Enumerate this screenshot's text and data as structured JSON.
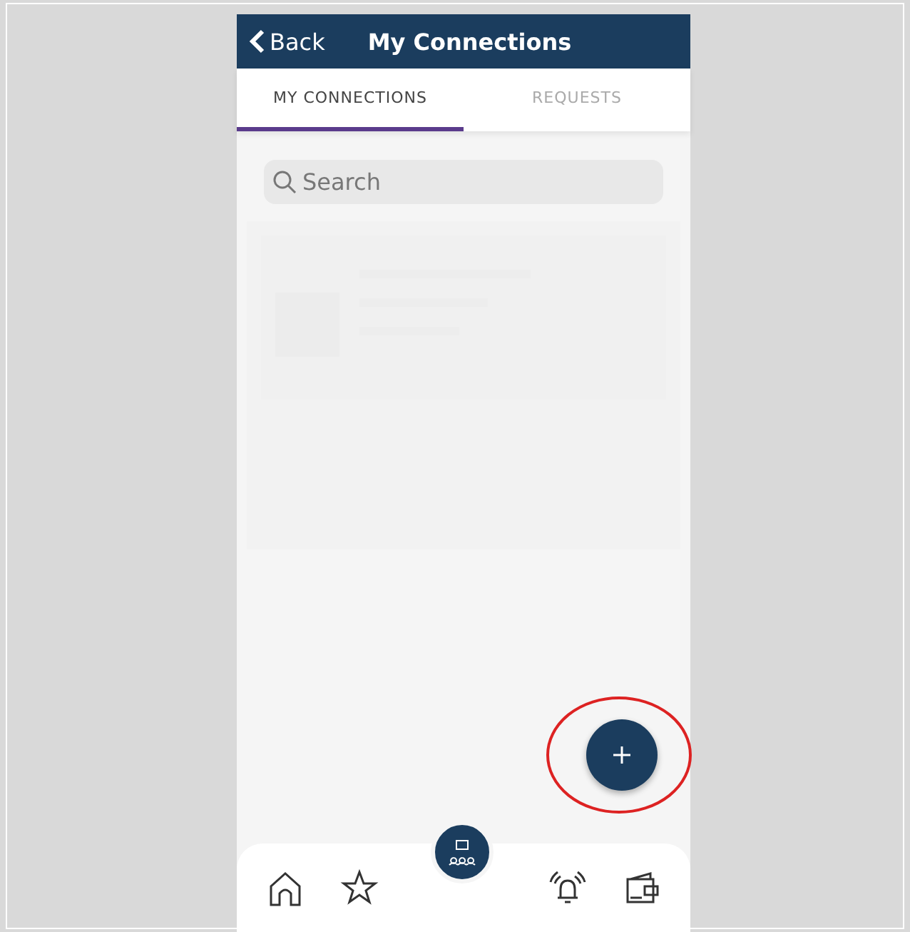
{
  "header": {
    "back": "Back",
    "title": "My Connections"
  },
  "tabs": [
    {
      "label": "MY CONNECTIONS",
      "selected": true
    },
    {
      "label": "REQUESTS",
      "selected": false
    }
  ],
  "search": {
    "placeholder": "Search"
  },
  "nav": [
    {
      "kind": "home"
    },
    {
      "kind": "star"
    },
    {
      "kind": "alarm"
    },
    {
      "kind": "wallet"
    }
  ]
}
